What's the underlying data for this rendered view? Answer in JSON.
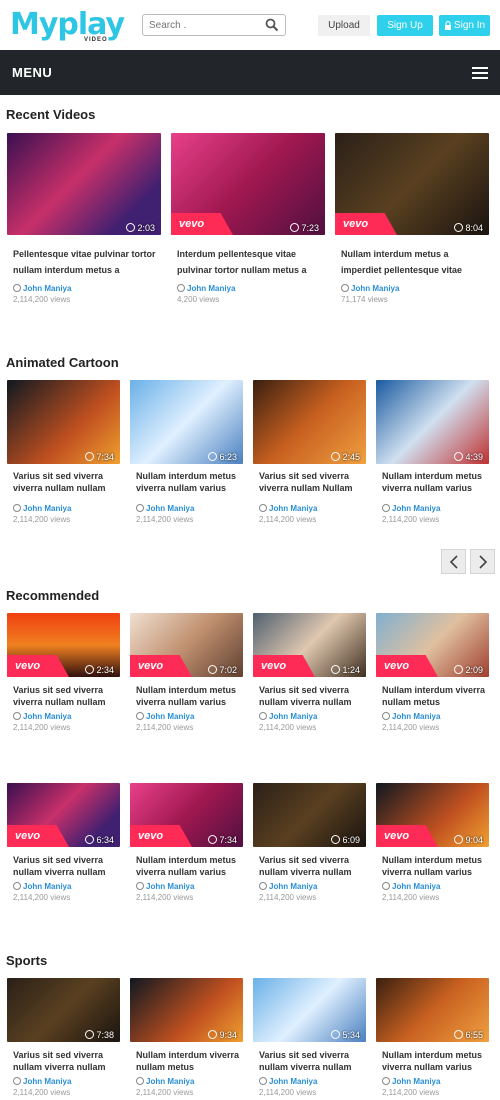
{
  "header": {
    "logo": "Myplay",
    "logo_sub": "VIDEO",
    "search_placeholder": "Search .",
    "upload_label": "Upload",
    "signup_label": "Sign Up",
    "signin_label": "Sign In"
  },
  "menubar": {
    "label": "MENU"
  },
  "sections": {
    "recent": {
      "title": "Recent Videos",
      "items": [
        {
          "title": "Pellentesque vitae pulvinar tortor nullam interdum metus a",
          "author": "John Maniya",
          "views": "2,114,200 views",
          "duration": "2:03",
          "vevo": false
        },
        {
          "title": "Interdum pellentesque vitae pulvinar tortor nullam metus a",
          "author": "John Maniya",
          "views": "4,200 views",
          "duration": "7:23",
          "vevo": true
        },
        {
          "title": "Nullam interdum metus a imperdiet pellentesque vitae",
          "author": "John Maniya",
          "views": "71,174 views",
          "duration": "8:04",
          "vevo": true
        }
      ]
    },
    "cartoon": {
      "title": "Animated Cartoon",
      "items": [
        {
          "title": "Varius sit sed viverra viverra nullam nullam",
          "author": "John Maniya",
          "views": "2,114,200 views",
          "duration": "7:34"
        },
        {
          "title": "Nullam interdum metus viverra nullam varius",
          "author": "John Maniya",
          "views": "2,114,200 views",
          "duration": "6:23"
        },
        {
          "title": "Varius sit sed viverra viverra nullam Nullam",
          "author": "John Maniya",
          "views": "2,114,200 views",
          "duration": "2:45"
        },
        {
          "title": "Nullam interdum metus viverra nullam varius",
          "author": "John Maniya",
          "views": "2,114,200 views",
          "duration": "4:39"
        }
      ]
    },
    "recommended": {
      "title": "Recommended",
      "items": [
        {
          "title": "Varius sit sed viverra viverra nullam nullam",
          "author": "John Maniya",
          "views": "2,114,200 views",
          "duration": "2:34",
          "vevo": true
        },
        {
          "title": "Nullam interdum metus viverra nullam varius",
          "author": "John Maniya",
          "views": "2,114,200 views",
          "duration": "7:02",
          "vevo": true
        },
        {
          "title": "Varius sit sed viverra nullam viverra nullam",
          "author": "John Maniya",
          "views": "2,114,200 views",
          "duration": "1:24",
          "vevo": true
        },
        {
          "title": "Nullam interdum viverra nullam metus",
          "author": "John Maniya",
          "views": "2,114,200 views",
          "duration": "2:09",
          "vevo": true
        },
        {
          "title": "Varius sit sed viverra nullam viverra nullam",
          "author": "John Maniya",
          "views": "2,114,200 views",
          "duration": "6:34",
          "vevo": true
        },
        {
          "title": "Nullam interdum metus viverra nullam varius",
          "author": "John Maniya",
          "views": "2,114,200 views",
          "duration": "7:34",
          "vevo": true
        },
        {
          "title": "Varius sit sed viverra nullam viverra nullam",
          "author": "John Maniya",
          "views": "2,114,200 views",
          "duration": "6:09",
          "vevo": false
        },
        {
          "title": "Nullam interdum metus viverra nullam varius",
          "author": "John Maniya",
          "views": "2,114,200 views",
          "duration": "9:04",
          "vevo": true
        }
      ]
    },
    "sports": {
      "title": "Sports",
      "items": [
        {
          "title": "Varius sit sed viverra nullam viverra nullam",
          "author": "John Maniya",
          "views": "2,114,200 views",
          "duration": "7:38"
        },
        {
          "title": "Nullam interdum viverra nullam metus",
          "author": "John Maniya",
          "views": "2,114,200 views",
          "duration": "9:34"
        },
        {
          "title": "Varius sit sed viverra nullam viverra nullam",
          "author": "John Maniya",
          "views": "2,114,200 views",
          "duration": "5:34"
        },
        {
          "title": "Nullam interdum metus viverra nullam varius",
          "author": "John Maniya",
          "views": "2,114,200 views",
          "duration": "6:55"
        }
      ]
    }
  },
  "colors": {
    "accent": "#2fd0ec",
    "menubar": "#22252a",
    "vevo": "#ff2b57",
    "author": "#2a8fd6"
  }
}
